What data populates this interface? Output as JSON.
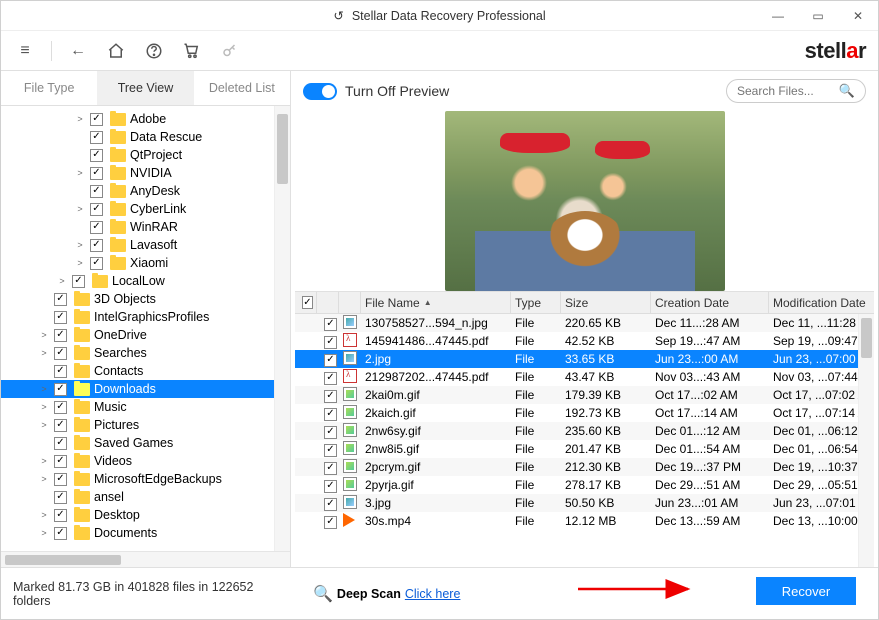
{
  "window": {
    "title": "Stellar Data Recovery Professional"
  },
  "brand": {
    "name_a": "stell",
    "name_b": "a",
    "name_c": "r"
  },
  "tabs": {
    "t0": "File Type",
    "t1": "Tree View",
    "t2": "Deleted List",
    "activeIndex": 1
  },
  "tree": [
    {
      "depth": 4,
      "label": "Adobe",
      "checked": true,
      "exp": ">"
    },
    {
      "depth": 4,
      "label": "Data Rescue",
      "checked": true,
      "exp": ""
    },
    {
      "depth": 4,
      "label": "QtProject",
      "checked": true,
      "exp": ""
    },
    {
      "depth": 4,
      "label": "NVIDIA",
      "checked": true,
      "exp": ">"
    },
    {
      "depth": 4,
      "label": "AnyDesk",
      "checked": true,
      "exp": ""
    },
    {
      "depth": 4,
      "label": "CyberLink",
      "checked": true,
      "exp": ">"
    },
    {
      "depth": 4,
      "label": "WinRAR",
      "checked": true,
      "exp": ""
    },
    {
      "depth": 4,
      "label": "Lavasoft",
      "checked": true,
      "exp": ">"
    },
    {
      "depth": 4,
      "label": "Xiaomi",
      "checked": true,
      "exp": ">"
    },
    {
      "depth": 3,
      "label": "LocalLow",
      "checked": true,
      "exp": ">"
    },
    {
      "depth": 2,
      "label": "3D Objects",
      "checked": true,
      "exp": ""
    },
    {
      "depth": 2,
      "label": "IntelGraphicsProfiles",
      "checked": true,
      "exp": ""
    },
    {
      "depth": 2,
      "label": "OneDrive",
      "checked": true,
      "exp": ">"
    },
    {
      "depth": 2,
      "label": "Searches",
      "checked": true,
      "exp": ">"
    },
    {
      "depth": 2,
      "label": "Contacts",
      "checked": true,
      "exp": ""
    },
    {
      "depth": 2,
      "label": "Downloads",
      "checked": true,
      "exp": ">",
      "selected": true
    },
    {
      "depth": 2,
      "label": "Music",
      "checked": true,
      "exp": ">"
    },
    {
      "depth": 2,
      "label": "Pictures",
      "checked": true,
      "exp": ">"
    },
    {
      "depth": 2,
      "label": "Saved Games",
      "checked": true,
      "exp": ""
    },
    {
      "depth": 2,
      "label": "Videos",
      "checked": true,
      "exp": ">"
    },
    {
      "depth": 2,
      "label": "MicrosoftEdgeBackups",
      "checked": true,
      "exp": ">"
    },
    {
      "depth": 2,
      "label": "ansel",
      "checked": true,
      "exp": ""
    },
    {
      "depth": 2,
      "label": "Desktop",
      "checked": true,
      "exp": ">"
    },
    {
      "depth": 2,
      "label": "Documents",
      "checked": true,
      "exp": ">"
    }
  ],
  "preview": {
    "toggle_label": "Turn Off Preview"
  },
  "search": {
    "placeholder": "Search Files..."
  },
  "cols": {
    "name": "File Name",
    "type": "Type",
    "size": "Size",
    "cd": "Creation Date",
    "md": "Modification Date"
  },
  "rows": [
    {
      "icon": "img",
      "name": "130758527...594_n.jpg",
      "type": "File",
      "size": "220.65 KB",
      "cd": "Dec 11...:28 AM",
      "md": "Dec 11, ...11:28 AM"
    },
    {
      "icon": "pdf",
      "name": "145941486...47445.pdf",
      "type": "File",
      "size": "42.52 KB",
      "cd": "Sep 19...:47 AM",
      "md": "Sep 19, ...09:47 AM"
    },
    {
      "icon": "img",
      "name": "2.jpg",
      "type": "File",
      "size": "33.65 KB",
      "cd": "Jun 23...:00 AM",
      "md": "Jun 23, ...07:00 AM",
      "selected": true
    },
    {
      "icon": "pdf",
      "name": "212987202...47445.pdf",
      "type": "File",
      "size": "43.47 KB",
      "cd": "Nov 03...:43 AM",
      "md": "Nov 03, ...07:44 AM"
    },
    {
      "icon": "gif",
      "name": "2kai0m.gif",
      "type": "File",
      "size": "179.39 KB",
      "cd": "Oct 17...:02 AM",
      "md": "Oct 17, ...07:02 AM"
    },
    {
      "icon": "gif",
      "name": "2kaich.gif",
      "type": "File",
      "size": "192.73 KB",
      "cd": "Oct 17...:14 AM",
      "md": "Oct 17, ...07:14 AM"
    },
    {
      "icon": "gif",
      "name": "2nw6sy.gif",
      "type": "File",
      "size": "235.60 KB",
      "cd": "Dec 01...:12 AM",
      "md": "Dec 01, ...06:12 AM"
    },
    {
      "icon": "gif",
      "name": "2nw8i5.gif",
      "type": "File",
      "size": "201.47 KB",
      "cd": "Dec 01...:54 AM",
      "md": "Dec 01, ...06:54 AM"
    },
    {
      "icon": "gif",
      "name": "2pcrym.gif",
      "type": "File",
      "size": "212.30 KB",
      "cd": "Dec 19...:37 PM",
      "md": "Dec 19, ...10:37 PM"
    },
    {
      "icon": "gif",
      "name": "2pyrja.gif",
      "type": "File",
      "size": "278.17 KB",
      "cd": "Dec 29...:51 AM",
      "md": "Dec 29, ...05:51 AM"
    },
    {
      "icon": "img",
      "name": "3.jpg",
      "type": "File",
      "size": "50.50 KB",
      "cd": "Jun 23...:01 AM",
      "md": "Jun 23, ...07:01 AM"
    },
    {
      "icon": "vid",
      "name": "30s.mp4",
      "type": "File",
      "size": "12.12 MB",
      "cd": "Dec 13...:59 AM",
      "md": "Dec 13, ...10:00 AM"
    }
  ],
  "footer": {
    "marked": "Marked 81.73 GB in 401828 files in 122652 folders",
    "deep_label": "Deep Scan",
    "deep_link": "Click here",
    "recover": "Recover"
  }
}
